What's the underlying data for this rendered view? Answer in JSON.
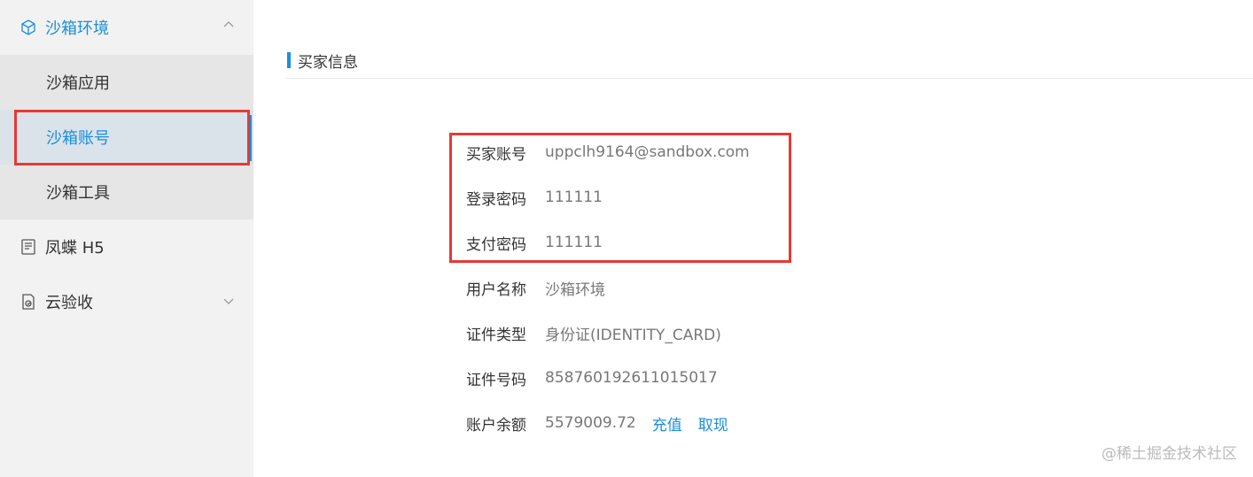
{
  "sidebar": {
    "group": {
      "label": "沙箱环境",
      "icon": "cube-icon",
      "expanded": true
    },
    "sub_items": [
      {
        "label": "沙箱应用"
      },
      {
        "label": "沙箱账号",
        "active": true
      },
      {
        "label": "沙箱工具"
      }
    ],
    "items": [
      {
        "label": "凤蝶 H5",
        "icon": "h5-page-icon"
      },
      {
        "label": "云验收",
        "icon": "document-check-icon"
      }
    ]
  },
  "main": {
    "section_title": "买家信息",
    "info": [
      {
        "label": "买家账号",
        "value": "uppclh9164@sandbox.com"
      },
      {
        "label": "登录密码",
        "value": "111111"
      },
      {
        "label": "支付密码",
        "value": "111111"
      },
      {
        "label": "用户名称",
        "value": "沙箱环境"
      },
      {
        "label": "证件类型",
        "value": "身份证(IDENTITY_CARD)"
      },
      {
        "label": "证件号码",
        "value": "858760192611015017"
      },
      {
        "label": "账户余额",
        "value": "5579009.72",
        "actions": [
          "充值",
          "取现"
        ]
      }
    ]
  },
  "watermark": "@稀土掘金技术社区",
  "colors": {
    "accent": "#1a8fdd",
    "highlight": "#e53935",
    "sidebar_bg": "#f2f2f2"
  }
}
